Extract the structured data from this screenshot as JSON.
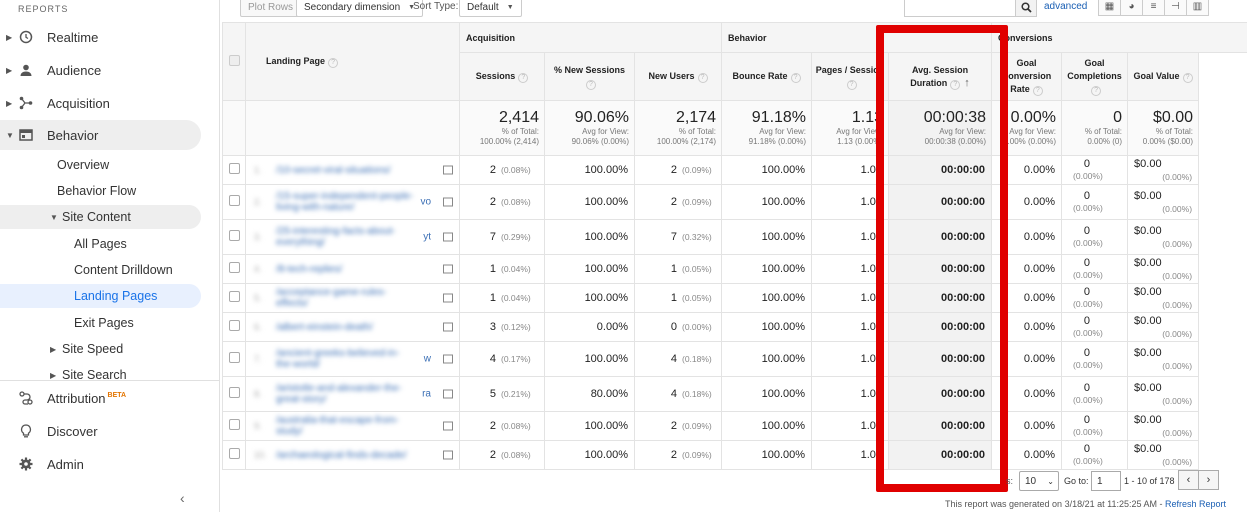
{
  "sidebar": {
    "reports_label": "REPORTS",
    "items": [
      {
        "label": "Realtime",
        "icon": "clock-icon"
      },
      {
        "label": "Audience",
        "icon": "person-icon"
      },
      {
        "label": "Acquisition",
        "icon": "acquisition-icon"
      },
      {
        "label": "Behavior",
        "icon": "behavior-icon"
      }
    ],
    "behavior_sub": {
      "overview": "Overview",
      "behavior_flow": "Behavior Flow",
      "site_content": "Site Content",
      "all_pages": "All Pages",
      "content_drilldown": "Content Drilldown",
      "landing_pages": "Landing Pages",
      "exit_pages": "Exit Pages",
      "site_speed": "Site Speed",
      "site_search": "Site Search"
    },
    "bottom": [
      {
        "label": "Attribution",
        "badge": "BETA",
        "icon": "attribution-icon"
      },
      {
        "label": "Discover",
        "icon": "lightbulb-icon"
      },
      {
        "label": "Admin",
        "icon": "gear-icon"
      }
    ],
    "collapse_glyph": "‹"
  },
  "toolbar": {
    "plot_rows": "Plot Rows",
    "secondary_dimension": "Secondary dimension",
    "sort_type_label": "Sort Type:",
    "sort_type_value": "Default",
    "advanced": "advanced"
  },
  "table": {
    "groups": {
      "acquisition": "Acquisition",
      "behavior": "Behavior",
      "conversions": "Conversions"
    },
    "columns": {
      "landing_page": "Landing Page",
      "sessions": "Sessions",
      "new_sessions": "% New Sessions",
      "new_users": "New Users",
      "bounce_rate": "Bounce Rate",
      "pages_session": "Pages / Session",
      "avg_duration_1": "Avg. Session",
      "avg_duration_2": "Duration",
      "goal_conv_1": "Goal Conversion",
      "goal_conv_2": "Rate",
      "goal_comp_1": "Goal",
      "goal_comp_2": "Completions",
      "goal_value": "Goal Value"
    },
    "totals": {
      "sessions": {
        "big": "2,414",
        "s1": "% of Total:",
        "s2": "100.00% (2,414)"
      },
      "new_sessions": {
        "big": "90.06%",
        "s1": "Avg for View:",
        "s2": "90.06% (0.00%)"
      },
      "new_users": {
        "big": "2,174",
        "s1": "% of Total:",
        "s2": "100.00% (2,174)"
      },
      "bounce_rate": {
        "big": "91.18%",
        "s1": "Avg for View:",
        "s2": "91.18% (0.00%)"
      },
      "pages_session": {
        "big": "1.13",
        "s1": "Avg for View:",
        "s2": "1.13 (0.00%)"
      },
      "avg_duration": {
        "big": "00:00:38",
        "s1": "Avg for View:",
        "s2": "00:00:38 (0.00%)"
      },
      "goal_conv": {
        "big": "0.00%",
        "s1": "Avg for View:",
        "s2": "0.00% (0.00%)"
      },
      "goal_comp": {
        "big": "0",
        "s1": "% of Total:",
        "s2": "0.00% (0)"
      },
      "goal_value": {
        "big": "$0.00",
        "s1": "% of Total:",
        "s2": "0.00% ($0.00)"
      }
    },
    "rows": [
      {
        "idx": "1.",
        "page": "/10-secret-viral-situations/",
        "clip": "",
        "sessions": "2",
        "sess_pct": "(0.08%)",
        "new_sess": "100.00%",
        "new_users": "2",
        "nu_pct": "(0.09%)",
        "bounce": "100.00%",
        "pages": "1.00",
        "dur": "00:00:00",
        "conv": "0.00%",
        "comp": "0",
        "comp_pct": "(0.00%)",
        "value": "$0.00",
        "val_pct": "(0.00%)"
      },
      {
        "idx": "2.",
        "page": "/15-super-independent-people-living-with-nature/",
        "clip": "vo",
        "sessions": "2",
        "sess_pct": "(0.08%)",
        "new_sess": "100.00%",
        "new_users": "2",
        "nu_pct": "(0.09%)",
        "bounce": "100.00%",
        "pages": "1.00",
        "dur": "00:00:00",
        "conv": "0.00%",
        "comp": "0",
        "comp_pct": "(0.00%)",
        "value": "$0.00",
        "val_pct": "(0.00%)"
      },
      {
        "idx": "3.",
        "page": "/25-interesting-facts-about-everything/",
        "clip": "yt",
        "sessions": "7",
        "sess_pct": "(0.29%)",
        "new_sess": "100.00%",
        "new_users": "7",
        "nu_pct": "(0.32%)",
        "bounce": "100.00%",
        "pages": "1.00",
        "dur": "00:00:00",
        "conv": "0.00%",
        "comp": "0",
        "comp_pct": "(0.00%)",
        "value": "$0.00",
        "val_pct": "(0.00%)"
      },
      {
        "idx": "4.",
        "page": "/8-tech-replies/",
        "clip": "",
        "sessions": "1",
        "sess_pct": "(0.04%)",
        "new_sess": "100.00%",
        "new_users": "1",
        "nu_pct": "(0.05%)",
        "bounce": "100.00%",
        "pages": "1.00",
        "dur": "00:00:00",
        "conv": "0.00%",
        "comp": "0",
        "comp_pct": "(0.00%)",
        "value": "$0.00",
        "val_pct": "(0.00%)"
      },
      {
        "idx": "5.",
        "page": "/acceptance-game-rules-effects/",
        "clip": "",
        "sessions": "1",
        "sess_pct": "(0.04%)",
        "new_sess": "100.00%",
        "new_users": "1",
        "nu_pct": "(0.05%)",
        "bounce": "100.00%",
        "pages": "1.00",
        "dur": "00:00:00",
        "conv": "0.00%",
        "comp": "0",
        "comp_pct": "(0.00%)",
        "value": "$0.00",
        "val_pct": "(0.00%)"
      },
      {
        "idx": "6.",
        "page": "/albert-einstein-death/",
        "clip": "",
        "sessions": "3",
        "sess_pct": "(0.12%)",
        "new_sess": "0.00%",
        "new_users": "0",
        "nu_pct": "(0.00%)",
        "bounce": "100.00%",
        "pages": "1.00",
        "dur": "00:00:00",
        "conv": "0.00%",
        "comp": "0",
        "comp_pct": "(0.00%)",
        "value": "$0.00",
        "val_pct": "(0.00%)"
      },
      {
        "idx": "7.",
        "page": "/ancient-greeks-believed-in-the-world/",
        "clip": "w",
        "sessions": "4",
        "sess_pct": "(0.17%)",
        "new_sess": "100.00%",
        "new_users": "4",
        "nu_pct": "(0.18%)",
        "bounce": "100.00%",
        "pages": "1.00",
        "dur": "00:00:00",
        "conv": "0.00%",
        "comp": "0",
        "comp_pct": "(0.00%)",
        "value": "$0.00",
        "val_pct": "(0.00%)"
      },
      {
        "idx": "8.",
        "page": "/aristotle-and-alexander-the-great-story/",
        "clip": "ra",
        "sessions": "5",
        "sess_pct": "(0.21%)",
        "new_sess": "80.00%",
        "new_users": "4",
        "nu_pct": "(0.18%)",
        "bounce": "100.00%",
        "pages": "1.00",
        "dur": "00:00:00",
        "conv": "0.00%",
        "comp": "0",
        "comp_pct": "(0.00%)",
        "value": "$0.00",
        "val_pct": "(0.00%)"
      },
      {
        "idx": "9.",
        "page": "/australia-that-escape-from-study/",
        "clip": "",
        "sessions": "2",
        "sess_pct": "(0.08%)",
        "new_sess": "100.00%",
        "new_users": "2",
        "nu_pct": "(0.09%)",
        "bounce": "100.00%",
        "pages": "1.00",
        "dur": "00:00:00",
        "conv": "0.00%",
        "comp": "0",
        "comp_pct": "(0.00%)",
        "value": "$0.00",
        "val_pct": "(0.00%)"
      },
      {
        "idx": "10.",
        "page": "/archaeological-finds-decade/",
        "clip": "",
        "sessions": "2",
        "sess_pct": "(0.08%)",
        "new_sess": "100.00%",
        "new_users": "2",
        "nu_pct": "(0.09%)",
        "bounce": "100.00%",
        "pages": "1.00",
        "dur": "00:00:00",
        "conv": "0.00%",
        "comp": "0",
        "comp_pct": "(0.00%)",
        "value": "$0.00",
        "val_pct": "(0.00%)"
      }
    ]
  },
  "pagination": {
    "show_label": "s:",
    "rows_value": "10",
    "goto_label": "Go to:",
    "goto_value": "1",
    "range": "1 - 10 of 178"
  },
  "footer": {
    "generated": "This report was generated on 3/18/21 at 11:25:25 AM - ",
    "refresh": "Refresh Report"
  },
  "colors": {
    "highlight": "#e00000",
    "link": "#1a5fb4",
    "selected_nav": "#1a73e8"
  }
}
